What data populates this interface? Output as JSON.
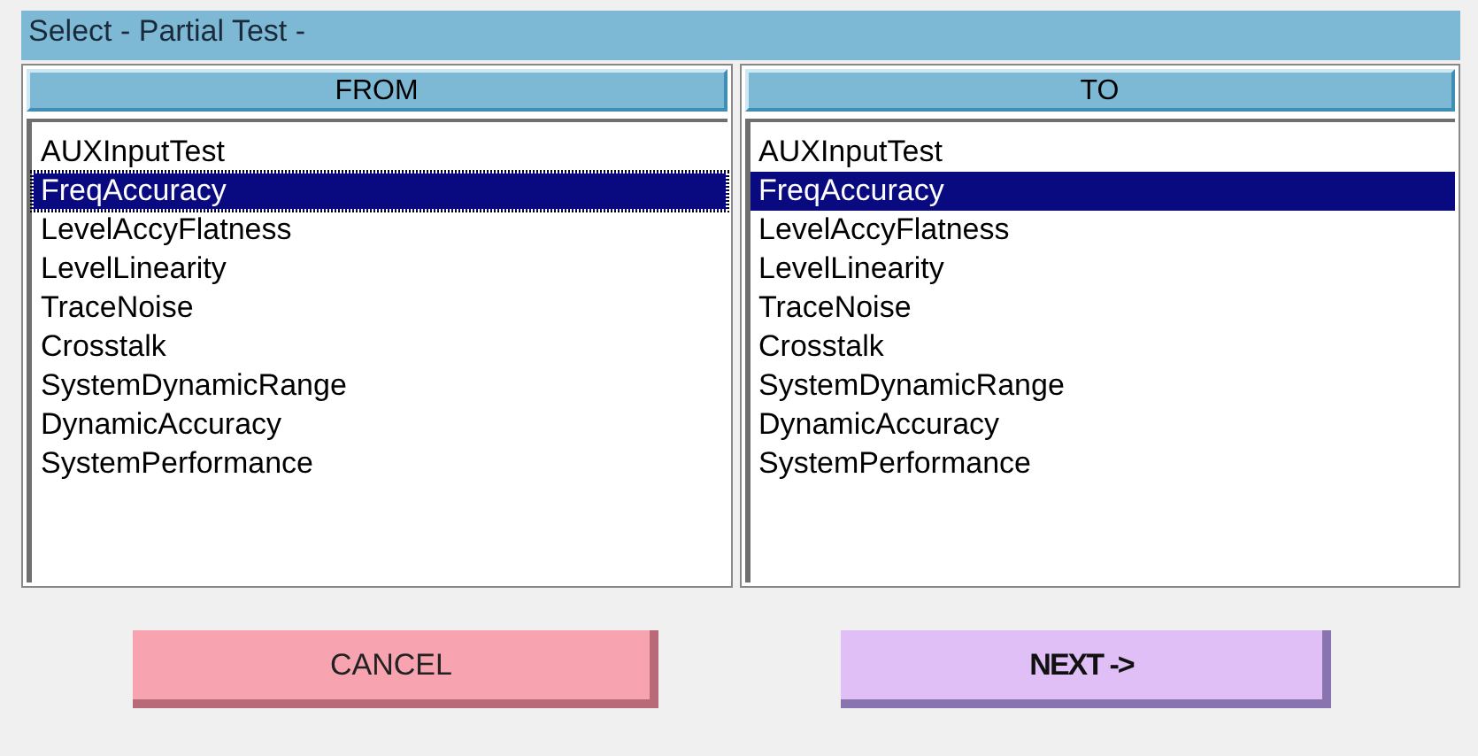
{
  "window": {
    "title": "Select - Partial Test -"
  },
  "lists": [
    {
      "heading": "FROM",
      "items": [
        {
          "label": "AUXInputTest",
          "selected": false
        },
        {
          "label": "FreqAccuracy",
          "selected": true
        },
        {
          "label": "LevelAccyFlatness",
          "selected": false
        },
        {
          "label": "LevelLinearity",
          "selected": false
        },
        {
          "label": "TraceNoise",
          "selected": false
        },
        {
          "label": "Crosstalk",
          "selected": false
        },
        {
          "label": "SystemDynamicRange",
          "selected": false
        },
        {
          "label": "DynamicAccuracy",
          "selected": false
        },
        {
          "label": "SystemPerformance",
          "selected": false
        }
      ]
    },
    {
      "heading": "TO",
      "items": [
        {
          "label": "AUXInputTest",
          "selected": false
        },
        {
          "label": "FreqAccuracy",
          "selected": true
        },
        {
          "label": "LevelAccyFlatness",
          "selected": false
        },
        {
          "label": "LevelLinearity",
          "selected": false
        },
        {
          "label": "TraceNoise",
          "selected": false
        },
        {
          "label": "Crosstalk",
          "selected": false
        },
        {
          "label": "SystemDynamicRange",
          "selected": false
        },
        {
          "label": "DynamicAccuracy",
          "selected": false
        },
        {
          "label": "SystemPerformance",
          "selected": false
        }
      ]
    }
  ],
  "buttons": [
    {
      "label": "CANCEL",
      "kind": "cancel"
    },
    {
      "label": "NEXT ->",
      "kind": "next"
    }
  ]
}
